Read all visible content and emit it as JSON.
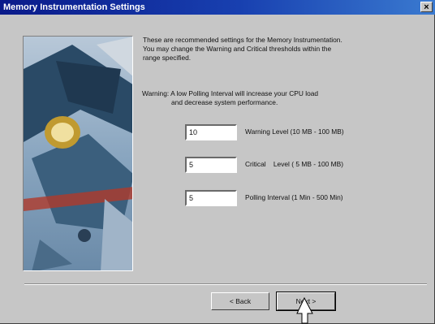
{
  "window": {
    "title": "Memory Instrumentation Settings",
    "close_glyph": "×"
  },
  "intro": [
    "These are recommended settings for the Memory Instrumentation.",
    "You may change the Warning and Critical thresholds within the",
    "range specified."
  ],
  "warning": {
    "line1": "Warning: A low Polling Interval will increase your CPU load",
    "line2": "and decrease system performance."
  },
  "fields": [
    {
      "value": "10",
      "label": "Warning Level (10 MB - 100 MB)"
    },
    {
      "value": "5",
      "label": "Critical    Level ( 5 MB - 100 MB)"
    },
    {
      "value": "5",
      "label": "Polling Interval (1 Min - 500 Min)"
    }
  ],
  "buttons": {
    "back": "< Back",
    "next": "Next >"
  },
  "colors": {
    "titlebar_start": "#0a1a8a",
    "titlebar_end": "#3a7ad0",
    "dialog_bg": "#c6c6c6"
  }
}
